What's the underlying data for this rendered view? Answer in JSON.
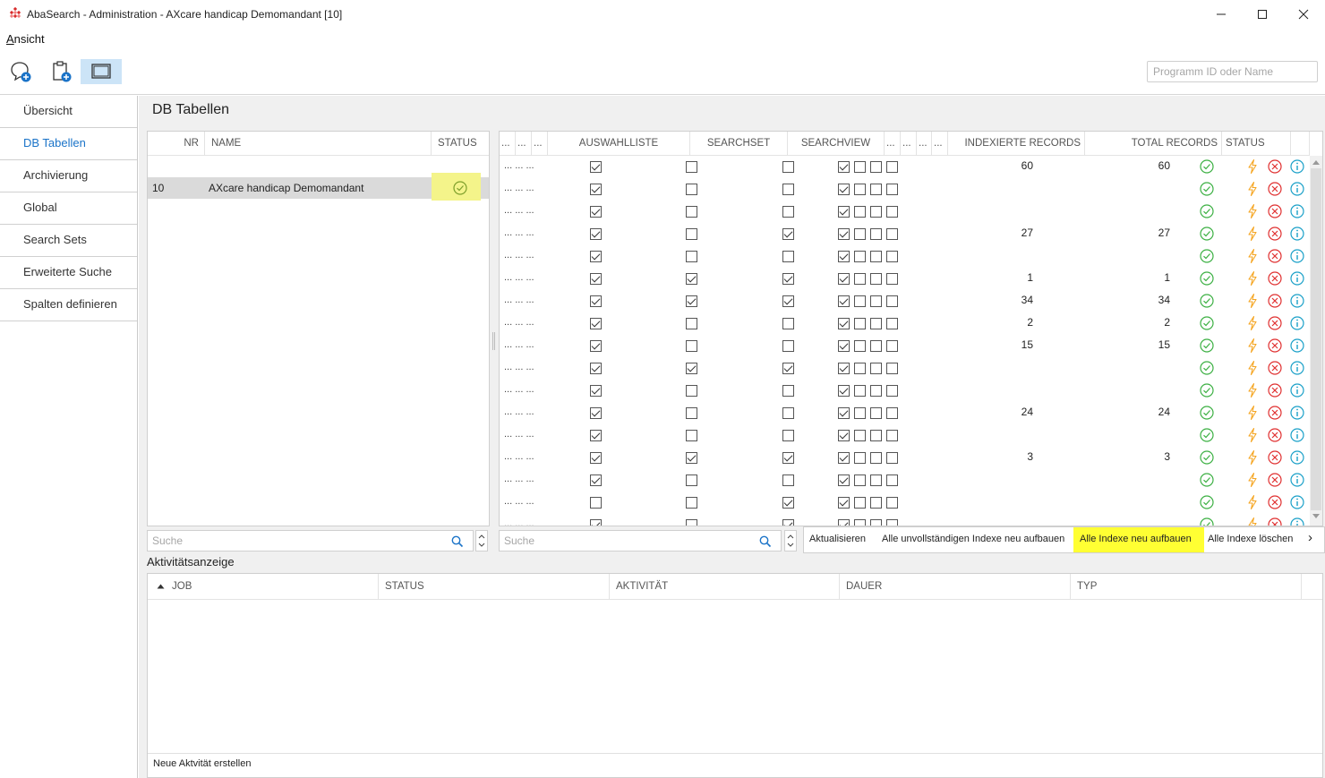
{
  "window": {
    "title": "AbaSearch - Administration - AXcare handicap Demomandant [10]"
  },
  "menu": {
    "view_prefix": "A",
    "view_rest": "nsicht"
  },
  "toolbar": {
    "search_placeholder": "Programm ID oder Name"
  },
  "sidebar": {
    "items": [
      {
        "label": "Übersicht"
      },
      {
        "label": "DB Tabellen"
      },
      {
        "label": "Archivierung"
      },
      {
        "label": "Global"
      },
      {
        "label": "Search Sets"
      },
      {
        "label": "Erweiterte Suche"
      },
      {
        "label": "Spalten definieren"
      }
    ],
    "active_index": 1
  },
  "main": {
    "title": "DB Tabellen",
    "left_table": {
      "headers": {
        "nr": "NR",
        "name": "NAME",
        "status": "STATUS"
      },
      "rows": [
        {
          "nr": "10",
          "name": "AXcare handicap Demomandant",
          "status": "ok"
        }
      ],
      "search_placeholder": "Suche"
    },
    "right_table": {
      "headers": {
        "c1": "...",
        "c2": "...",
        "c3": "...",
        "auswahlliste": "AUSWAHLLISTE",
        "searchset": "SEARCHSET",
        "searchview": "SEARCHVIEW",
        "c4": "...",
        "c5": "...",
        "c6": "...",
        "c7": "...",
        "indexed": "INDEXIERTE RECORDS",
        "total": "TOTAL RECORDS",
        "status": "STATUS"
      },
      "rows": [
        {
          "dots": "... ... ...",
          "auswahl": true,
          "set": false,
          "view": false,
          "flags": [
            true,
            false,
            false,
            false
          ],
          "indexed": "60",
          "total": "60"
        },
        {
          "dots": "... ... ...",
          "auswahl": true,
          "set": false,
          "view": false,
          "flags": [
            true,
            false,
            false,
            false
          ],
          "indexed": "",
          "total": ""
        },
        {
          "dots": "... ... ...",
          "auswahl": true,
          "set": false,
          "view": false,
          "flags": [
            true,
            false,
            false,
            false
          ],
          "indexed": "",
          "total": ""
        },
        {
          "dots": "... ... ...",
          "auswahl": true,
          "set": false,
          "view": true,
          "flags": [
            true,
            false,
            false,
            false
          ],
          "indexed": "27",
          "total": "27"
        },
        {
          "dots": "... ... ...",
          "auswahl": true,
          "set": false,
          "view": false,
          "flags": [
            true,
            false,
            false,
            false
          ],
          "indexed": "",
          "total": ""
        },
        {
          "dots": "... ... ...",
          "auswahl": true,
          "set": true,
          "view": true,
          "flags": [
            true,
            false,
            false,
            false
          ],
          "indexed": "1",
          "total": "1"
        },
        {
          "dots": "... ... ...",
          "auswahl": true,
          "set": true,
          "view": true,
          "flags": [
            true,
            false,
            false,
            false
          ],
          "indexed": "34",
          "total": "34"
        },
        {
          "dots": "... ... ...",
          "auswahl": true,
          "set": false,
          "view": false,
          "flags": [
            true,
            false,
            false,
            false
          ],
          "indexed": "2",
          "total": "2"
        },
        {
          "dots": "... ... ...",
          "auswahl": true,
          "set": false,
          "view": false,
          "flags": [
            true,
            false,
            false,
            false
          ],
          "indexed": "15",
          "total": "15"
        },
        {
          "dots": "... ... ...",
          "auswahl": true,
          "set": true,
          "view": true,
          "flags": [
            true,
            false,
            false,
            false
          ],
          "indexed": "",
          "total": ""
        },
        {
          "dots": "... ... ...",
          "auswahl": true,
          "set": false,
          "view": false,
          "flags": [
            true,
            false,
            false,
            false
          ],
          "indexed": "",
          "total": ""
        },
        {
          "dots": "... ... ...",
          "auswahl": true,
          "set": false,
          "view": false,
          "flags": [
            true,
            false,
            false,
            false
          ],
          "indexed": "24",
          "total": "24"
        },
        {
          "dots": "... ... ...",
          "auswahl": true,
          "set": false,
          "view": false,
          "flags": [
            true,
            false,
            false,
            false
          ],
          "indexed": "",
          "total": ""
        },
        {
          "dots": "... ... ...",
          "auswahl": true,
          "set": true,
          "view": true,
          "flags": [
            true,
            false,
            false,
            false
          ],
          "indexed": "3",
          "total": "3"
        },
        {
          "dots": "... ... ...",
          "auswahl": true,
          "set": false,
          "view": false,
          "flags": [
            true,
            false,
            false,
            false
          ],
          "indexed": "",
          "total": ""
        },
        {
          "dots": "... ... ...",
          "auswahl": false,
          "set": false,
          "view": true,
          "flags": [
            true,
            false,
            false,
            false
          ],
          "indexed": "",
          "total": ""
        },
        {
          "dots": "... ... ...",
          "auswahl": true,
          "set": false,
          "view": true,
          "flags": [
            true,
            false,
            false,
            false
          ],
          "indexed": "",
          "total": ""
        }
      ],
      "search_placeholder": "Suche"
    },
    "actions": [
      {
        "label": "Aktualisieren",
        "highlight": false
      },
      {
        "label": "Alle unvollständigen Indexe neu aufbauen",
        "highlight": false
      },
      {
        "label": "Alle Indexe neu aufbauen",
        "highlight": true
      },
      {
        "label": "Alle Indexe löschen",
        "highlight": false
      }
    ],
    "more_chevron": "›",
    "activity": {
      "title": "Aktivitätsanzeige",
      "headers": {
        "job": "JOB",
        "status": "STATUS",
        "activity": "AKTIVITÄT",
        "duration": "DAUER",
        "type": "TYP"
      },
      "footer_link": "Neue Aktvität erstellen"
    }
  },
  "colors": {
    "accent": "#1a73c8",
    "status_ok": "#3cb043",
    "lightning": "#f5a623",
    "delete": "#e03030",
    "info": "#1aa0c8",
    "highlight": "#ffff33"
  }
}
